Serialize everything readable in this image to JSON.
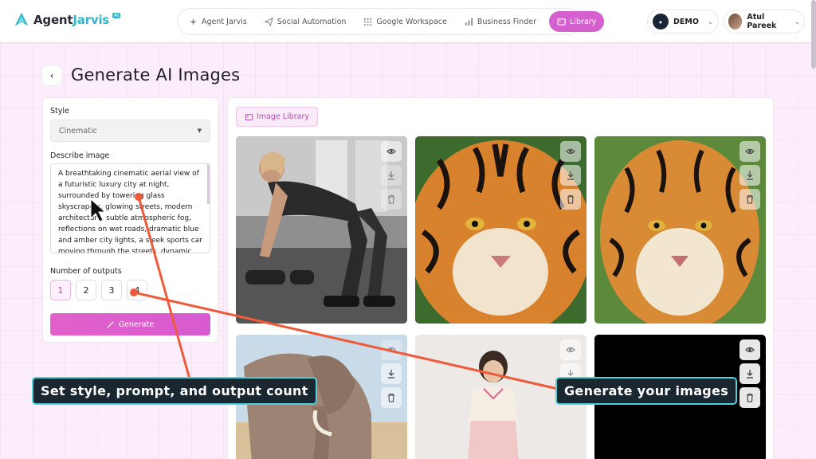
{
  "brand": {
    "name_part1": "Agent",
    "name_part2": "Jarvis",
    "tag": "AI"
  },
  "nav": [
    {
      "label": "Agent Jarvis",
      "icon": "sparkle-icon"
    },
    {
      "label": "Social Automation",
      "icon": "send-icon"
    },
    {
      "label": "Google Workspace",
      "icon": "grid-icon"
    },
    {
      "label": "Business Finder",
      "icon": "bar-chart-icon"
    },
    {
      "label": "Library",
      "icon": "image-icon",
      "active": true
    }
  ],
  "account": {
    "workspace": "DEMO",
    "user": "Atul Pareek"
  },
  "page": {
    "title": "Generate AI Images",
    "back_icon": "chevron-left-icon"
  },
  "form": {
    "style_label": "Style",
    "style_value": "Cinematic",
    "describe_label": "Describe image",
    "prompt": "A breathtaking cinematic aerial view of a futuristic luxury city at night, surrounded by towering glass skyscrapers, glowing streets, modern architecture, subtle atmospheric fog, reflections on wet roads, dramatic blue and amber city lights, a sleek sports car moving through the streets, dynamic",
    "outputs_label": "Number of outputs",
    "outputs": [
      "1",
      "2",
      "3",
      "4"
    ],
    "outputs_selected": "1",
    "generate_label": "Generate"
  },
  "library": {
    "button_label": "Image Library",
    "images": [
      {
        "subject": "woman doing dumbbell rows in gym"
      },
      {
        "subject": "tiger face close-up"
      },
      {
        "subject": "tiger face close-up"
      },
      {
        "subject": "elephant"
      },
      {
        "subject": "child in pink outfit"
      },
      {
        "subject": "black image"
      }
    ],
    "actions": [
      "eye-icon",
      "download-icon",
      "trash-icon"
    ]
  },
  "callouts": {
    "left": "Set style, prompt, and output count",
    "right": "Generate your images"
  },
  "colors": {
    "accent": "#d65fcf",
    "callout_bg": "#1a2630",
    "callout_border": "#4fd0d8",
    "arrow": "#ee5a3a"
  }
}
